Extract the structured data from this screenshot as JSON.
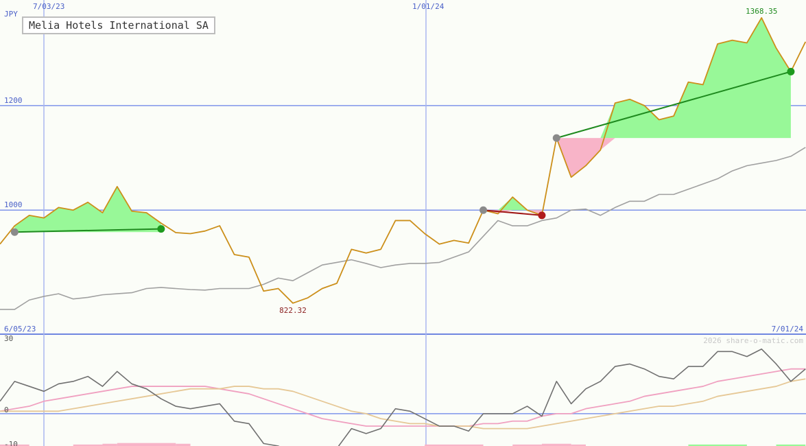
{
  "title": "Melia Hotels International SA",
  "watermark": "2026 share-o-matic.com",
  "chart_data": [
    {
      "type": "line",
      "panel": "price",
      "title": "Melia Hotels International SA",
      "ylabel": "JPY",
      "ylim": [
        764,
        1402
      ],
      "ytick_labels": [
        "1000",
        "1200"
      ],
      "yticks": [
        1000,
        1200
      ],
      "top_date_labels": [
        "7/03/23",
        "1/01/24"
      ],
      "bottom_date_labels": [
        "6/05/23",
        "7/01/24"
      ],
      "grid": true,
      "high_label": "1368.35",
      "low_label": "822.32",
      "series": [
        {
          "key": "price",
          "color": "#cc8f1a",
          "values": [
            935,
            970,
            990,
            985,
            1005,
            1000,
            1015,
            995,
            1045,
            998,
            995,
            975,
            957,
            955,
            960,
            970,
            915,
            910,
            845,
            850,
            822,
            832,
            850,
            860,
            925,
            918,
            925,
            980,
            980,
            955,
            935,
            942,
            937,
            1000,
            993,
            1025,
            1000,
            990,
            1138,
            1063,
            1085,
            1115,
            1205,
            1212,
            1200,
            1173,
            1180,
            1245,
            1240,
            1318,
            1325,
            1320,
            1368,
            1310,
            1265,
            1322
          ]
        },
        {
          "key": "benchmark",
          "color": "#a0a0a0",
          "values": [
            810,
            810,
            828,
            835,
            840,
            830,
            833,
            838,
            840,
            842,
            850,
            852,
            850,
            848,
            847,
            850,
            850,
            850,
            858,
            870,
            865,
            880,
            895,
            900,
            905,
            898,
            890,
            895,
            898,
            898,
            900,
            910,
            920,
            950,
            980,
            970,
            970,
            980,
            985,
            1000,
            1002,
            990,
            1005,
            1017,
            1017,
            1030,
            1030,
            1040,
            1050,
            1060,
            1075,
            1085,
            1090,
            1095,
            1103,
            1120
          ]
        }
      ],
      "trades": [
        {
          "outcome": "gain",
          "color": "#1e8a1e",
          "entry": {
            "index": 1,
            "value": 958
          },
          "exit": {
            "index": 11,
            "value": 964
          }
        },
        {
          "outcome": "loss",
          "color": "#a01818",
          "entry": {
            "index": 33,
            "value": 1000
          },
          "exit": {
            "index": 37,
            "value": 990
          }
        },
        {
          "outcome": "gain",
          "color": "#1e8a1e",
          "entry": {
            "index": 38,
            "value": 1138
          },
          "exit": {
            "index": 54,
            "value": 1265
          }
        }
      ]
    },
    {
      "type": "line",
      "panel": "oscillator",
      "ylim": [
        -13,
        32
      ],
      "ytick_labels": [
        "30",
        "0",
        "-10"
      ],
      "yticks": [
        30,
        0,
        -10
      ],
      "grid": true,
      "series": [
        {
          "key": "oscillator",
          "color": "#707070",
          "values": [
            5,
            13,
            11,
            9,
            12,
            13,
            15,
            11,
            17,
            12,
            10,
            6,
            3,
            2,
            3,
            4,
            -3,
            -4,
            -12,
            -13,
            -16,
            -15,
            -14,
            -14,
            -6,
            -8,
            -6,
            2,
            1,
            -2,
            -5,
            -5,
            -7,
            0,
            0,
            0,
            3,
            -1,
            13,
            4,
            10,
            13,
            19,
            20,
            18,
            15,
            14,
            19,
            19,
            25,
            25,
            23,
            26,
            20,
            13,
            18
          ]
        },
        {
          "key": "average-fast",
          "color": "#f0a0c0",
          "values": [
            1,
            2,
            3,
            5,
            6,
            7,
            8,
            9,
            10,
            11,
            11,
            11,
            11,
            11,
            11,
            10,
            9,
            8,
            6,
            4,
            2,
            0,
            -2,
            -3,
            -4,
            -5,
            -5,
            -5,
            -5,
            -5,
            -5,
            -5,
            -5,
            -4,
            -4,
            -3,
            -3,
            -1,
            0,
            0,
            2,
            3,
            4,
            5,
            7,
            8,
            9,
            10,
            11,
            13,
            14,
            15,
            16,
            17,
            18,
            18
          ]
        },
        {
          "key": "average-slow",
          "color": "#e6c896",
          "values": [
            1,
            1,
            1,
            1,
            1,
            2,
            3,
            4,
            5,
            6,
            7,
            8,
            9,
            10,
            10,
            10,
            11,
            11,
            10,
            10,
            9,
            7,
            5,
            3,
            1,
            0,
            -2,
            -3,
            -4,
            -4,
            -5,
            -5,
            -5,
            -6,
            -6,
            -6,
            -6,
            -5,
            -4,
            -3,
            -2,
            -1,
            0,
            1,
            2,
            3,
            3,
            4,
            5,
            7,
            8,
            9,
            10,
            11,
            13,
            14
          ]
        }
      ],
      "histogram": [
        {
          "from": 0,
          "to": 2,
          "value": -2,
          "color": "#f8b4c8"
        },
        {
          "from": 5,
          "to": 7,
          "value": -2,
          "color": "#f8b4c8"
        },
        {
          "from": 7,
          "to": 8,
          "value": -3,
          "color": "#f8b4c8"
        },
        {
          "from": 8,
          "to": 12,
          "value": -4,
          "color": "#f8b4c8"
        },
        {
          "from": 12,
          "to": 13,
          "value": -3,
          "color": "#f8b4c8"
        },
        {
          "from": 29,
          "to": 33,
          "value": -2,
          "color": "#f8b4c8"
        },
        {
          "from": 35,
          "to": 37,
          "value": -2,
          "color": "#f8b4c8"
        },
        {
          "from": 37,
          "to": 39,
          "value": -3,
          "color": "#f8b4c8"
        },
        {
          "from": 39,
          "to": 40,
          "value": -2,
          "color": "#f8b4c8"
        },
        {
          "from": 47,
          "to": 51,
          "value": -2,
          "color": "#98f898"
        },
        {
          "from": 53,
          "to": 55,
          "value": -2,
          "color": "#98f898"
        }
      ]
    }
  ]
}
